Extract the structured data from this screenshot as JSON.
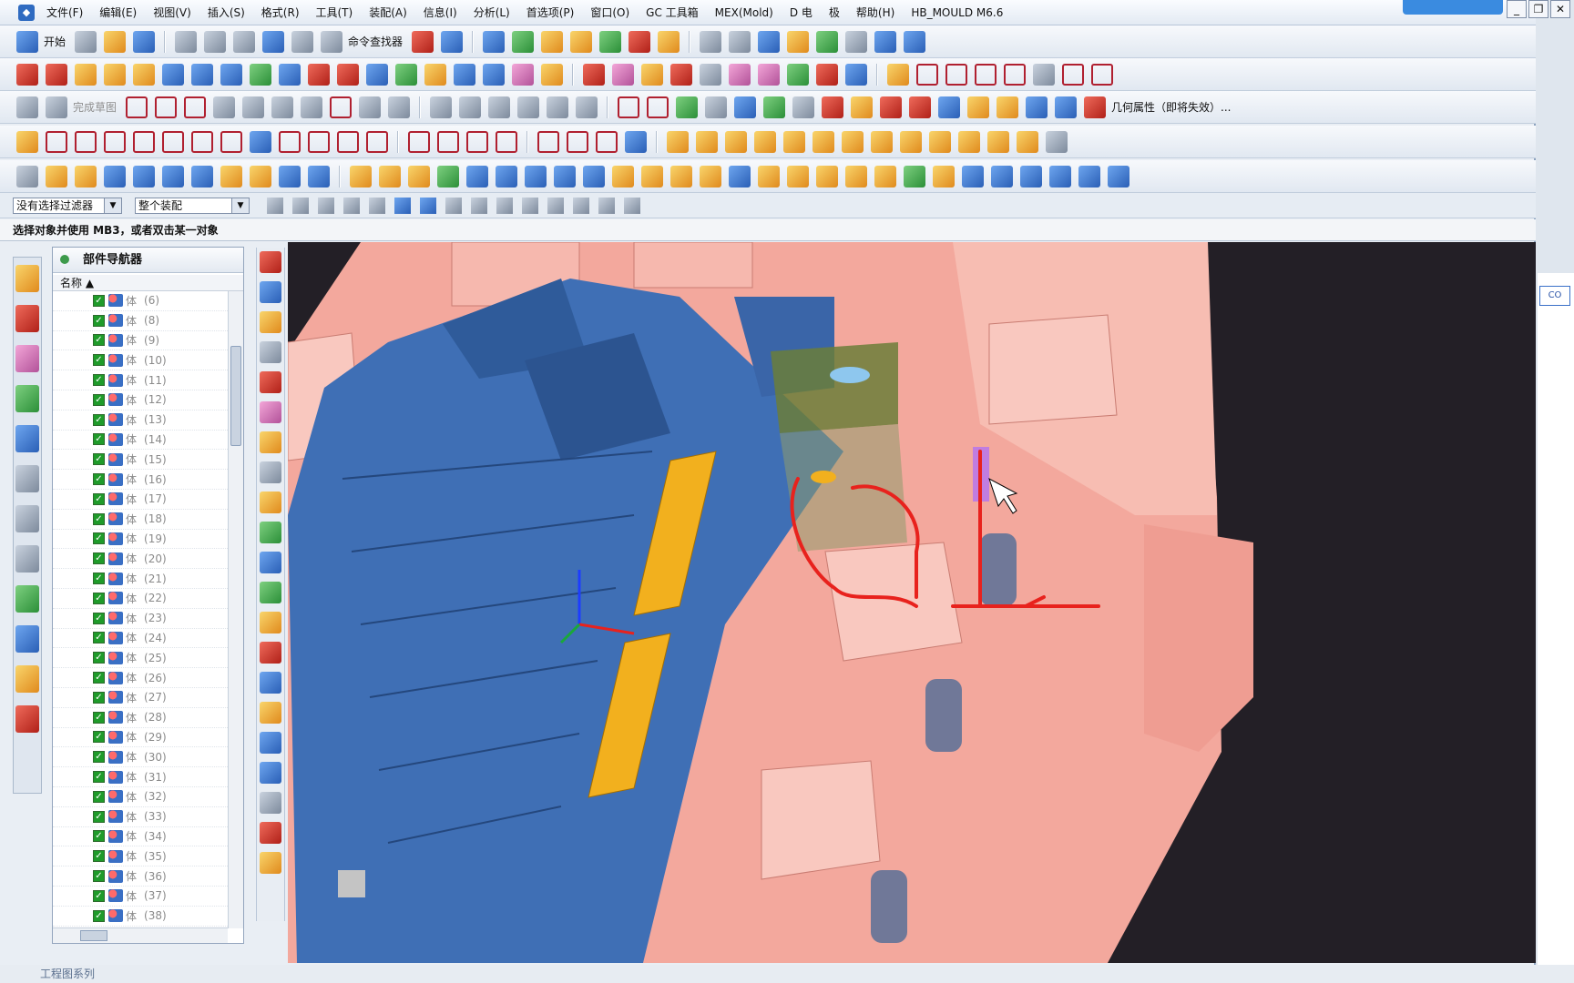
{
  "menu": {
    "items": [
      "文件(F)",
      "编辑(E)",
      "视图(V)",
      "插入(S)",
      "格式(R)",
      "工具(T)",
      "装配(A)",
      "信息(I)",
      "分析(L)",
      "首选项(P)",
      "窗口(O)",
      "GC 工具箱",
      "MEX(Mold)",
      "D 电",
      "极",
      "帮助(H)",
      "HB_MOULD M6.6"
    ]
  },
  "toolbar": {
    "start_label": "开始",
    "finder_label": "命令查找器",
    "sketch_label": "完成草图",
    "geom_label": "几何属性（即将失效）..."
  },
  "selection": {
    "filter": "没有选择过滤器",
    "scope": "整个装配"
  },
  "status": {
    "prompt": "选择对象并使用 MB3，或者双击某一对象"
  },
  "navigator": {
    "title": "部件导航器",
    "column": "名称",
    "row_label": "体",
    "rows": [
      "(6)",
      "(8)",
      "(9)",
      "(10)",
      "(11)",
      "(12)",
      "(13)",
      "(14)",
      "(15)",
      "(16)",
      "(17)",
      "(18)",
      "(19)",
      "(20)",
      "(21)",
      "(22)",
      "(23)",
      "(24)",
      "(25)",
      "(26)",
      "(27)",
      "(28)",
      "(29)",
      "(30)",
      "(31)",
      "(32)",
      "(33)",
      "(34)",
      "(35)",
      "(36)",
      "(37)",
      "(38)"
    ]
  },
  "bottom": {
    "hint": "工程图系列"
  },
  "right_hint": "CO",
  "colors": {
    "mold_pink": "#f4a79c",
    "part_blue": "#3f6fb5",
    "slider_green": "#6b7e3a",
    "highlight_yellow": "#f2b01e",
    "sketch_red": "#e8221d",
    "viewport_bg": "#231f26"
  }
}
